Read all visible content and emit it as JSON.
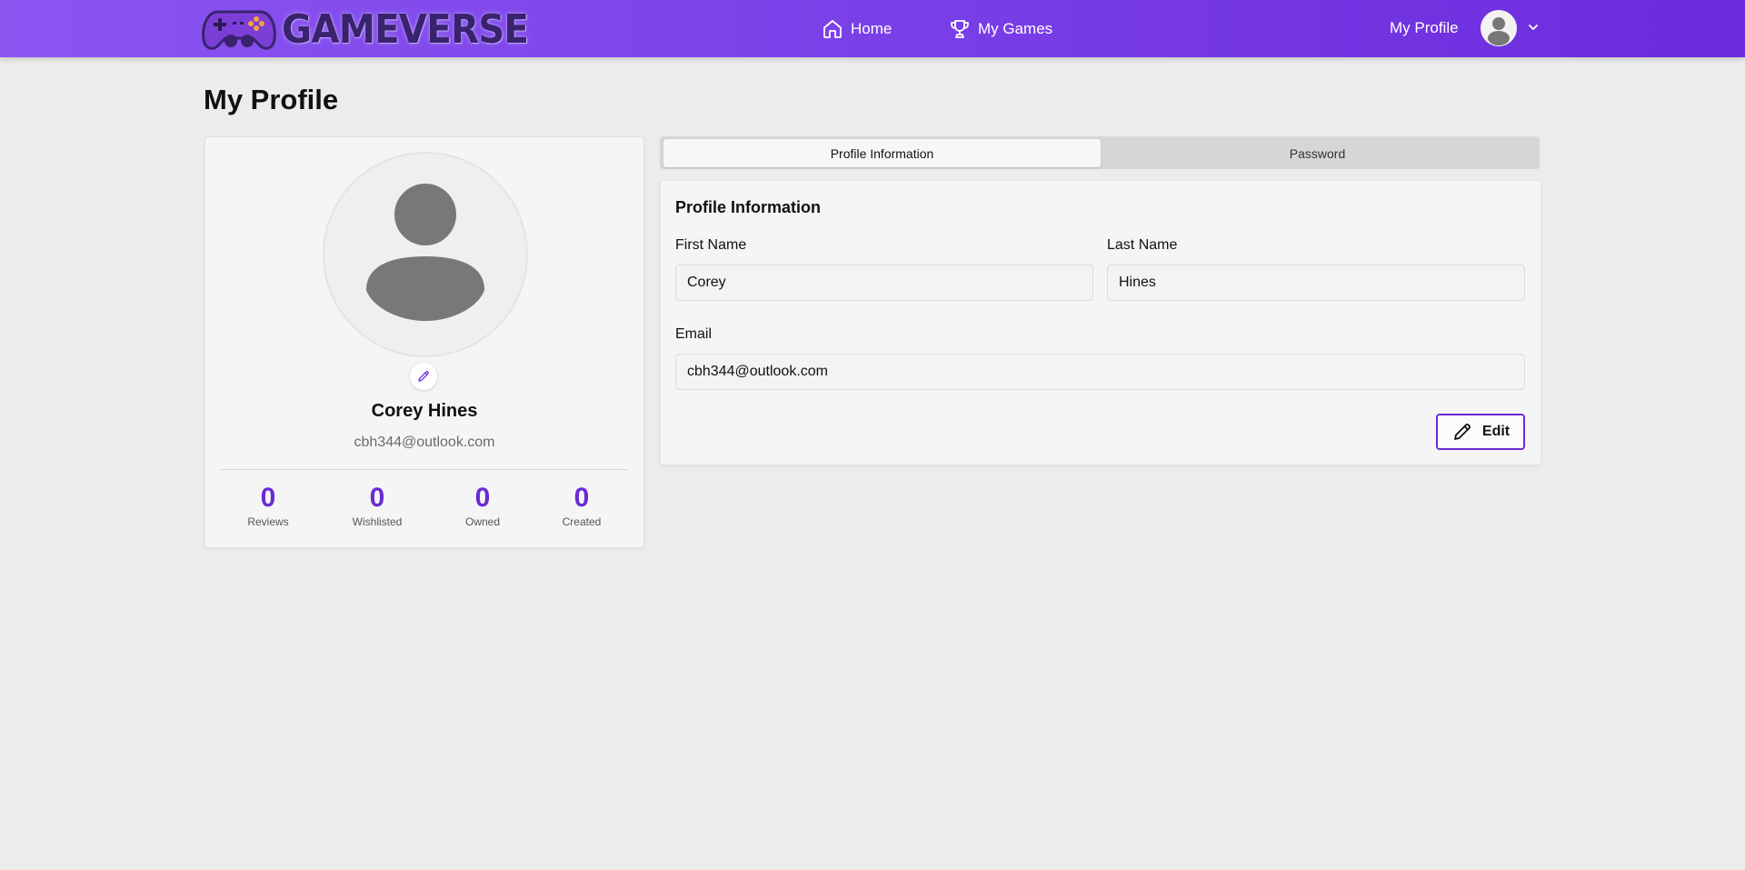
{
  "header": {
    "logo_text": "GAMEVERSE",
    "nav": [
      {
        "label": "Home",
        "icon": "home-icon"
      },
      {
        "label": "My Games",
        "icon": "trophy-icon"
      }
    ],
    "profile_label": "My Profile"
  },
  "page": {
    "title": "My Profile"
  },
  "profile_card": {
    "name": "Corey Hines",
    "email": "cbh344@outlook.com",
    "stats": [
      {
        "value": "0",
        "label": "Reviews"
      },
      {
        "value": "0",
        "label": "Wishlisted"
      },
      {
        "value": "0",
        "label": "Owned"
      },
      {
        "value": "0",
        "label": "Created"
      }
    ]
  },
  "tabs": [
    {
      "label": "Profile Information",
      "active": true
    },
    {
      "label": "Password",
      "active": false
    }
  ],
  "form": {
    "section_title": "Profile Information",
    "first_name_label": "First Name",
    "first_name_value": "Corey",
    "last_name_label": "Last Name",
    "last_name_value": "Hines",
    "email_label": "Email",
    "email_value": "cbh344@outlook.com",
    "edit_label": "Edit"
  },
  "colors": {
    "header_start": "#8b55f0",
    "header_end": "#6c2bdc",
    "accent": "#6a2bd5",
    "background": "#ececec"
  }
}
